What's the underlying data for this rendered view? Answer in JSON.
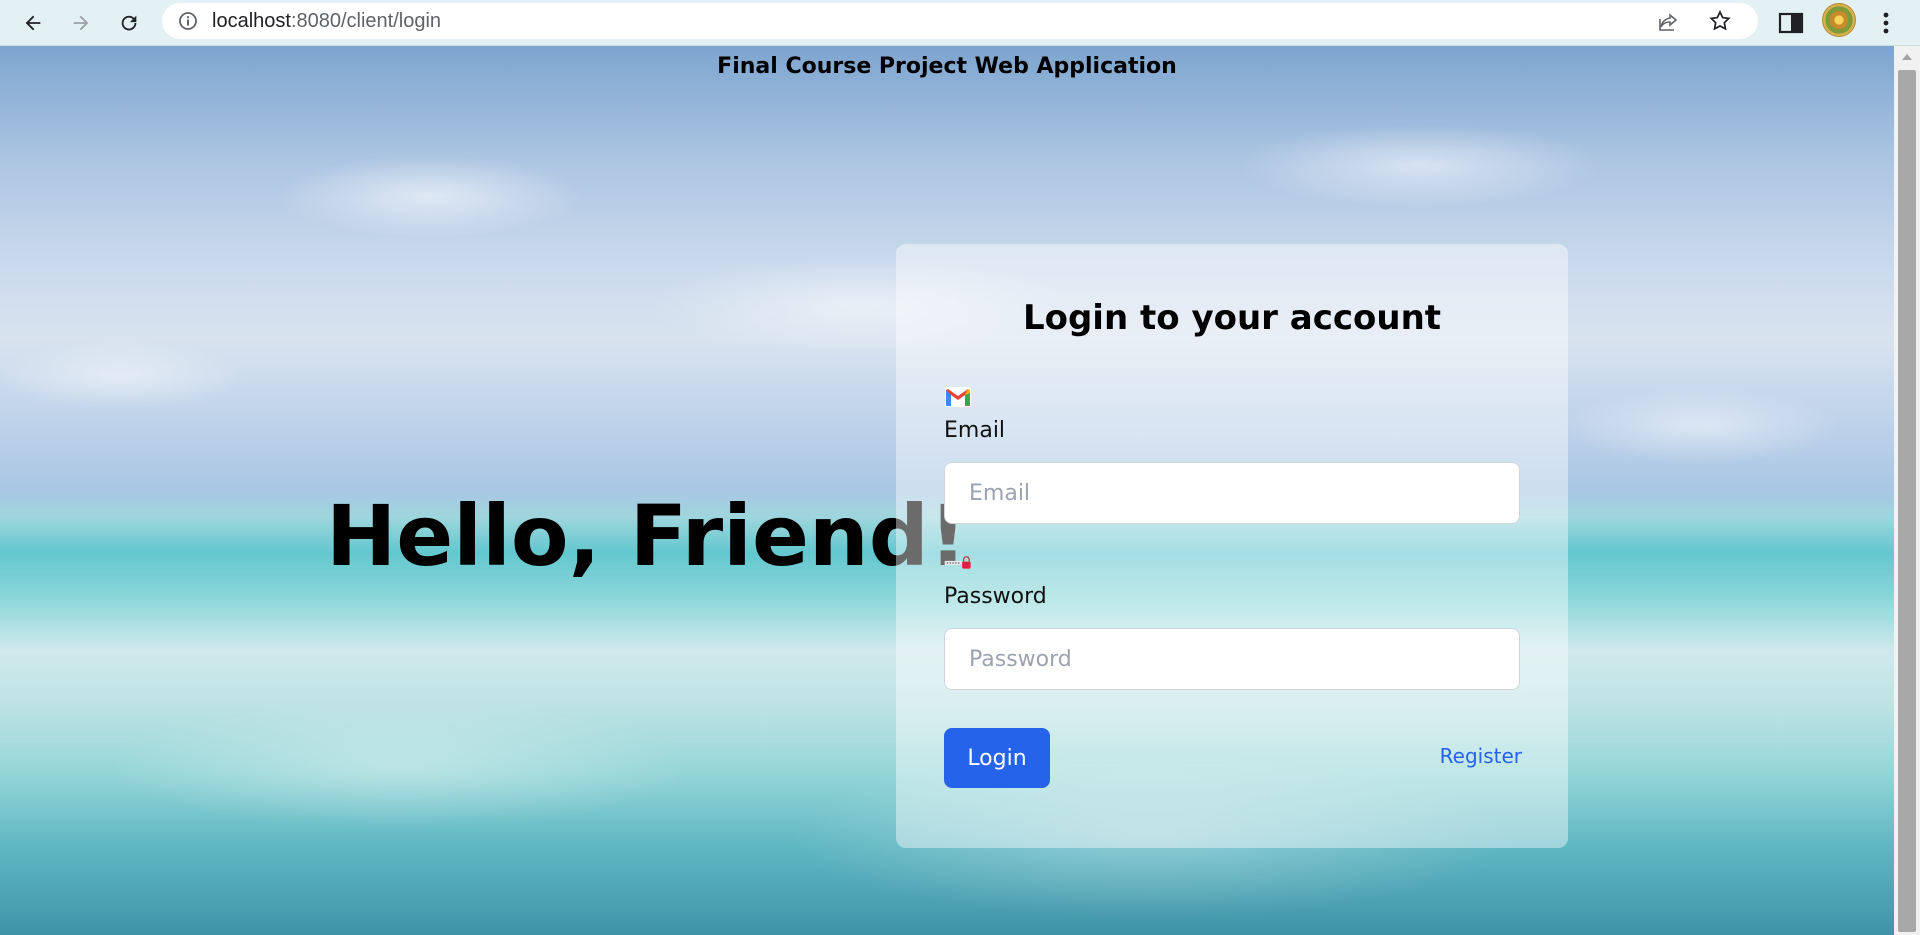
{
  "browser": {
    "url_host": "localhost",
    "url_rest": ":8080/client/login"
  },
  "page": {
    "site_title": "Final Course Project Web Application",
    "hero_text": "Hello, Friend!"
  },
  "login_form": {
    "title": "Login to your account",
    "email_label": "Email",
    "email_placeholder": "Email",
    "email_value": "",
    "email_icon": "gmail-icon",
    "password_label": "Password",
    "password_placeholder": "Password",
    "password_value": "",
    "password_icon": "password-lock-icon",
    "login_button": "Login",
    "register_link": "Register",
    "accent_color": "#2563eb"
  }
}
